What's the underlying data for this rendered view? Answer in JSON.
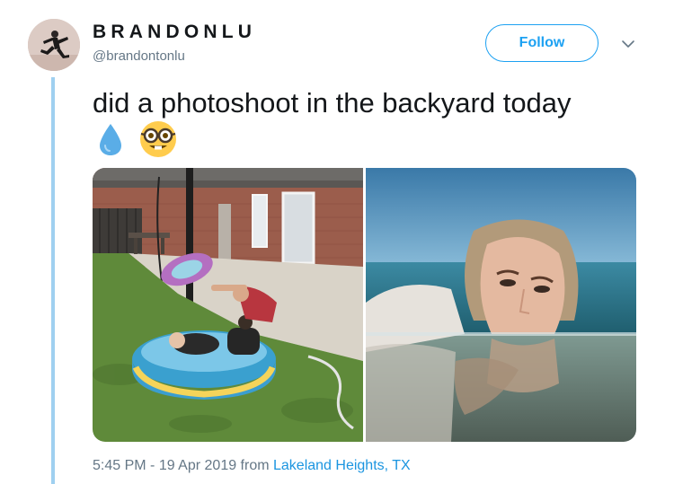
{
  "tweet": {
    "display_name": "BRANDONLU",
    "handle": "@brandontonlu",
    "follow_label": "Follow",
    "text": "did a photoshoot in the backyard today",
    "emojis": [
      "droplet-emoji",
      "nerd-face-emoji"
    ],
    "media": [
      {
        "name": "backyard-kiddie-pool-photo"
      },
      {
        "name": "underwater-selfie-photo"
      }
    ],
    "meta": {
      "time": "5:45 PM",
      "separator": " - ",
      "date": "19 Apr 2019",
      "from_label": " from ",
      "location": "Lakeland Heights, TX"
    }
  },
  "colors": {
    "accent": "#1da1f2",
    "link": "#1b95e0",
    "secondary_text": "#657786",
    "thread_line": "#9fd0f0"
  }
}
